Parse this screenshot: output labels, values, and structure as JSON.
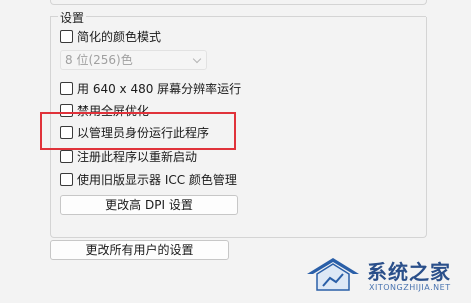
{
  "settings_group": {
    "title": "设置",
    "options": [
      {
        "id": "reduced-color",
        "label": "简化的颜色模式",
        "checked": false
      },
      {
        "id": "run-640",
        "label": "用 640 x 480 屏幕分辨率运行",
        "checked": false
      },
      {
        "id": "disable-fullscreen-opt",
        "label": "禁用全屏优化",
        "checked": false
      },
      {
        "id": "run-as-admin",
        "label": "以管理员身份运行此程序",
        "checked": false
      },
      {
        "id": "register-restart",
        "label": "注册此程序以重新启动",
        "checked": false
      },
      {
        "id": "legacy-icc",
        "label": "使用旧版显示器 ICC 颜色管理",
        "checked": false
      }
    ],
    "color_mode_select": {
      "value": "8 位(256)色",
      "disabled": true
    },
    "dpi_button_label": "更改高 DPI 设置"
  },
  "all_users_button_label": "更改所有用户的设置",
  "watermark": {
    "title": "系统之家",
    "url": "XITONGZHIJIA.NET"
  },
  "colors": {
    "highlight": "#e0323a",
    "window_bg": "#f3f3f3"
  }
}
